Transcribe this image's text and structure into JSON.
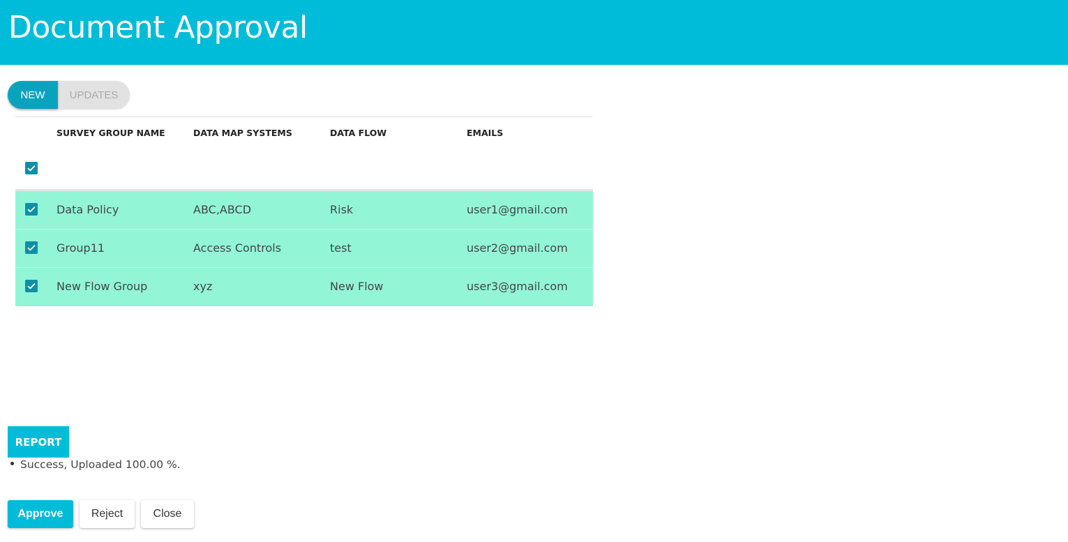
{
  "header": {
    "title": "Document Approval",
    "background": "#00bcd8"
  },
  "tabs": [
    {
      "label": "NEW",
      "active": true
    },
    {
      "label": "UPDATES",
      "active": false
    }
  ],
  "table": {
    "columns": [
      "SURVEY GROUP NAME",
      "DATA MAP SYSTEMS",
      "DATA FLOW",
      "EMAILS"
    ],
    "select_all_checked": true,
    "rows": [
      {
        "checked": true,
        "survey_group_name": "Data Policy",
        "data_map_systems": "ABC,ABCD",
        "data_flow": "Risk",
        "email": "user1@gmail.com"
      },
      {
        "checked": true,
        "survey_group_name": "Group11",
        "data_map_systems": "Access Controls",
        "data_flow": "test",
        "email": "user2@gmail.com"
      },
      {
        "checked": true,
        "survey_group_name": "New Flow Group",
        "data_map_systems": "xyz",
        "data_flow": "New Flow",
        "email": "user3@gmail.com"
      }
    ],
    "selected_row_color": "#92f6d6"
  },
  "report": {
    "label": "REPORT",
    "messages": [
      "Success, Uploaded 100.00 %."
    ]
  },
  "actions": {
    "approve_label": "Approve",
    "reject_label": "Reject",
    "close_label": "Close"
  },
  "icons": {
    "checkbox": "check-icon"
  }
}
